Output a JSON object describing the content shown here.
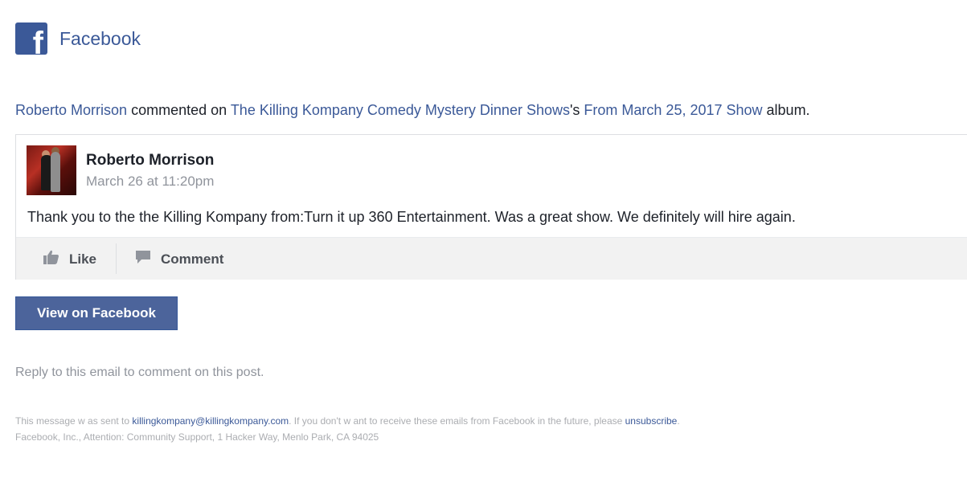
{
  "header": {
    "logo_letter": "f",
    "brand": "Facebook"
  },
  "notification": {
    "actor": "Roberto Morrison",
    "verb": " commented on ",
    "page": "The Killing Kompany Comedy Mystery Dinner Shows",
    "possessive": "'s ",
    "album": "From March 25, 2017 Show",
    "suffix": " album."
  },
  "comment": {
    "author": "Roberto Morrison",
    "timestamp": "March 26 at 11:20pm",
    "text": "Thank you to the the Killing Kompany from:Turn it up 360 Entertainment. Was a great show. We definitely will hire again."
  },
  "actions": {
    "like": "Like",
    "comment": "Comment"
  },
  "view_button": "View on Facebook",
  "reply_hint": "Reply to this email to comment on this post.",
  "footer": {
    "sent_prefix": "This message w as sent to ",
    "email": "killingkompany@killingkompany.com",
    "sent_suffix": ". If you don't w ant to receive these emails from Facebook in the future, please ",
    "unsubscribe": "unsubscribe",
    "period": ".",
    "address": "Facebook, Inc., Attention: Community Support, 1 Hacker Way, Menlo Park, CA 94025"
  },
  "colors": {
    "brand": "#3b5998",
    "button": "#4c649b",
    "muted": "#90949c"
  }
}
